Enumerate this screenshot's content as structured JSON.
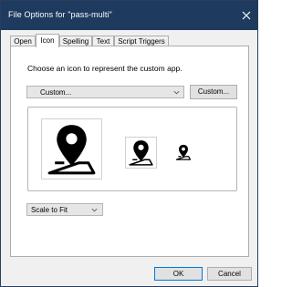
{
  "window": {
    "title": "File Options for \"pass-multi\""
  },
  "tabs": [
    {
      "label": "Open",
      "active": false
    },
    {
      "label": "Icon",
      "active": true
    },
    {
      "label": "Spelling",
      "active": false
    },
    {
      "label": "Text",
      "active": false
    },
    {
      "label": "Script Triggers",
      "active": false
    }
  ],
  "icon_panel": {
    "prompt": "Choose an icon to represent the custom app.",
    "icon_select": {
      "value": "Custom..."
    },
    "custom_button": "Custom...",
    "preview_icon": "map-pin-icon",
    "scale_select": {
      "value": "Scale to Fit"
    }
  },
  "footer": {
    "ok_label": "OK",
    "cancel_label": "Cancel"
  },
  "colors": {
    "titlebar": "#1f3a5f",
    "default_button_border": "#0078d7"
  }
}
